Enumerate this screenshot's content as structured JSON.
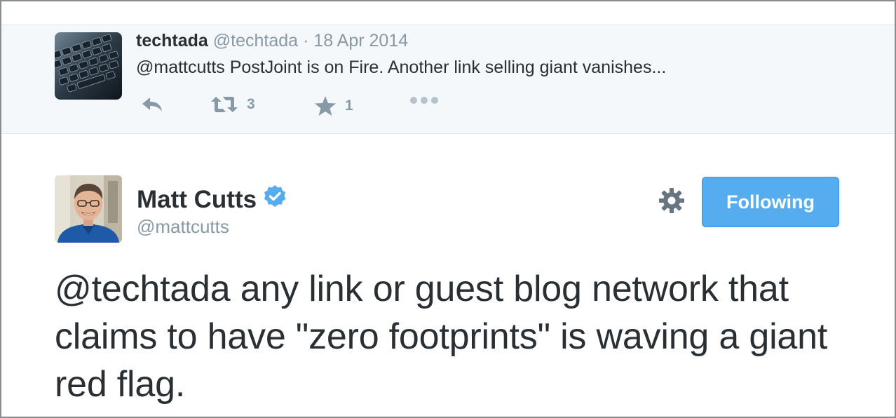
{
  "reply": {
    "author_name": "techtada",
    "author_handle": "@techtada",
    "separator": "·",
    "date": "18 Apr 2014",
    "mention": "@mattcutts",
    "text": " PostJoint is on Fire. Another link selling giant vanishes...",
    "retweet_count": "3",
    "favorite_count": "1"
  },
  "tweet": {
    "author_name": "Matt Cutts",
    "author_handle": "@mattcutts",
    "follow_label": "Following",
    "mention": "@techtada",
    "text": " any link or guest blog network that claims to have \"zero footprints\" is waving a giant red flag."
  },
  "icons": {
    "reply": "reply-icon",
    "retweet": "retweet-icon",
    "favorite": "star-icon",
    "more": "more-icon",
    "verified": "verified-badge-icon",
    "settings": "gear-icon"
  },
  "colors": {
    "accent": "#55acee",
    "muted": "#8899a6",
    "text": "#292f33",
    "reply_background": "#f5f8fa"
  }
}
